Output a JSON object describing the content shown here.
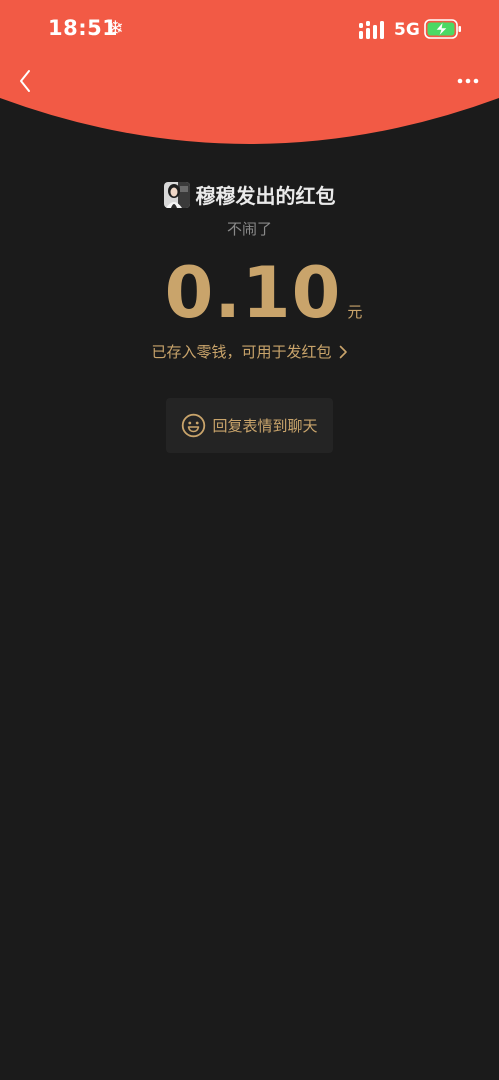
{
  "status_bar": {
    "time": "18:51",
    "weather_icon": "snowflake-icon",
    "network": "5G",
    "battery_icon": "battery-charging-icon"
  },
  "nav": {
    "back_icon": "chevron-left-icon",
    "more_icon": "more-dots-icon"
  },
  "colors": {
    "header_red": "#f25a45",
    "background": "#1b1b1b",
    "gold": "#c9a46b",
    "button_bg": "#242424"
  },
  "red_packet": {
    "sender_title": "穆穆发出的红包",
    "message": "不闹了",
    "amount": "0.10",
    "currency": "元",
    "wallet_notice": "已存入零钱，可用于发红包"
  },
  "reply": {
    "label": "回复表情到聊天",
    "icon": "smile-icon"
  }
}
